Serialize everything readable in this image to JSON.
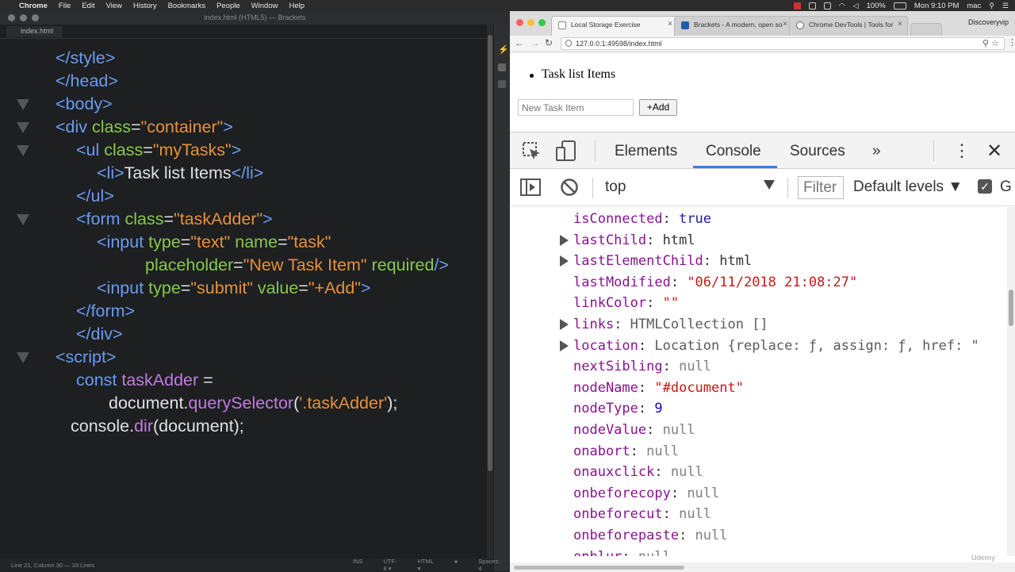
{
  "menubar": {
    "app": "Chrome",
    "items": [
      "File",
      "Edit",
      "View",
      "History",
      "Bookmarks",
      "People",
      "Window",
      "Help"
    ],
    "battery": "100%",
    "clock": "Mon 9:10 PM",
    "user": "mac"
  },
  "brackets": {
    "title": "index.html (HTML5) — Brackets",
    "tab": "index.html",
    "code": [
      [
        [
          "tg",
          "</style>"
        ]
      ],
      [
        [
          "tg",
          "</head>"
        ]
      ],
      [
        [
          "tg",
          "<body>"
        ]
      ],
      [
        [
          "tg",
          "<div "
        ],
        [
          "at",
          "class"
        ],
        [
          "tx",
          "="
        ],
        [
          "st",
          "\"container\""
        ],
        [
          "tg",
          ">"
        ]
      ],
      [
        [
          "tg",
          "<ul "
        ],
        [
          "at",
          "class"
        ],
        [
          "tx",
          "="
        ],
        [
          "st",
          "\"myTasks\""
        ],
        [
          "tg",
          ">"
        ]
      ],
      [
        [
          "tg",
          "<li>"
        ],
        [
          "tx",
          "Task list Items"
        ],
        [
          "tg",
          "</li>"
        ]
      ],
      [
        [
          "tg",
          "</ul>"
        ]
      ],
      [
        [
          "tg",
          "<form "
        ],
        [
          "at",
          "class"
        ],
        [
          "tx",
          "="
        ],
        [
          "st",
          "\"taskAdder\""
        ],
        [
          "tg",
          ">"
        ]
      ],
      [
        [
          "tg",
          "<input "
        ],
        [
          "at",
          "type"
        ],
        [
          "tx",
          "="
        ],
        [
          "st",
          "\"text\" "
        ],
        [
          "at",
          "name"
        ],
        [
          "tx",
          "="
        ],
        [
          "st",
          "\"task\""
        ]
      ],
      [
        [
          "at",
          "placeholder"
        ],
        [
          "tx",
          "="
        ],
        [
          "st",
          "\"New Task Item\" "
        ],
        [
          "at",
          "required"
        ],
        [
          "tg",
          "/>"
        ]
      ],
      [
        [
          "tg",
          "<input "
        ],
        [
          "at",
          "type"
        ],
        [
          "tx",
          "="
        ],
        [
          "st",
          "\"submit\" "
        ],
        [
          "at",
          "value"
        ],
        [
          "tx",
          "="
        ],
        [
          "st",
          "\"+Add\""
        ],
        [
          "tg",
          ">"
        ]
      ],
      [
        [
          "tg",
          "</form>"
        ]
      ],
      [
        [
          "tg",
          "</div>"
        ]
      ],
      [
        [
          "tg",
          "<script>"
        ]
      ],
      [
        [
          "kw",
          "const "
        ],
        [
          "vr",
          "taskAdder"
        ],
        [
          "tx",
          " ="
        ]
      ],
      [
        [
          "tx",
          "document."
        ],
        [
          "fn",
          "querySelector"
        ],
        [
          "tx",
          "("
        ],
        [
          "st",
          "'.taskAdder'"
        ],
        [
          "tx",
          ");"
        ]
      ],
      [
        [
          "tx",
          "console."
        ],
        [
          "fn",
          "dir"
        ],
        [
          "tx",
          "(document);"
        ]
      ]
    ],
    "status_left": "Line 21, Column 30 — 33 Lines",
    "status_right": [
      "INS",
      "UTF-8 ▾",
      "HTML ▾",
      "●",
      "Spaces: 4"
    ]
  },
  "chrome": {
    "tabs": [
      {
        "label": "Local Storage Exercise",
        "active": true
      },
      {
        "label": "Brackets - A modern, open so",
        "active": false
      },
      {
        "label": "Chrome DevTools | Tools for",
        "active": false
      }
    ],
    "user": "Discoveryvip",
    "url": "127.0.0.1:49598/index.html",
    "page": {
      "list_item": "Task list Items",
      "input_placeholder": "New Task Item",
      "add_button": "+Add"
    },
    "devtools": {
      "tabs": [
        "Elements",
        "Console",
        "Sources"
      ],
      "active_tab": "Console",
      "more": "»",
      "context": "top",
      "filter": "Filter",
      "levels": "Default levels ▼",
      "g": "G",
      "props": [
        {
          "key": "isConnected",
          "val": "true",
          "type": "vkw",
          "expand": false
        },
        {
          "key": "lastChild",
          "val": "html",
          "type": "vobj",
          "expand": true
        },
        {
          "key": "lastElementChild",
          "val": "html",
          "type": "vobj",
          "expand": true
        },
        {
          "key": "lastModified",
          "val": "\"06/11/2018 21:08:27\"",
          "type": "vstr",
          "expand": false
        },
        {
          "key": "linkColor",
          "val": "\"\"",
          "type": "vstr",
          "expand": false
        },
        {
          "key": "links",
          "val": "HTMLCollection []",
          "type": "vgray",
          "expand": true
        },
        {
          "key": "location",
          "val": "Location {replace: ƒ, assign: ƒ, href: \"",
          "type": "vgray",
          "expand": true
        },
        {
          "key": "nextSibling",
          "val": "null",
          "type": "vnull",
          "expand": false
        },
        {
          "key": "nodeName",
          "val": "\"#document\"",
          "type": "vstr",
          "expand": false
        },
        {
          "key": "nodeType",
          "val": "9",
          "type": "vnum",
          "expand": false
        },
        {
          "key": "nodeValue",
          "val": "null",
          "type": "vnull",
          "expand": false
        },
        {
          "key": "onabort",
          "val": "null",
          "type": "vnull",
          "expand": false
        },
        {
          "key": "onauxclick",
          "val": "null",
          "type": "vnull",
          "expand": false
        },
        {
          "key": "onbeforecopy",
          "val": "null",
          "type": "vnull",
          "expand": false
        },
        {
          "key": "onbeforecut",
          "val": "null",
          "type": "vnull",
          "expand": false
        },
        {
          "key": "onbeforepaste",
          "val": "null",
          "type": "vnull",
          "expand": false
        },
        {
          "key": "onblur",
          "val": "null",
          "type": "vnull",
          "expand": false
        }
      ]
    }
  },
  "watermark": "Udemy"
}
